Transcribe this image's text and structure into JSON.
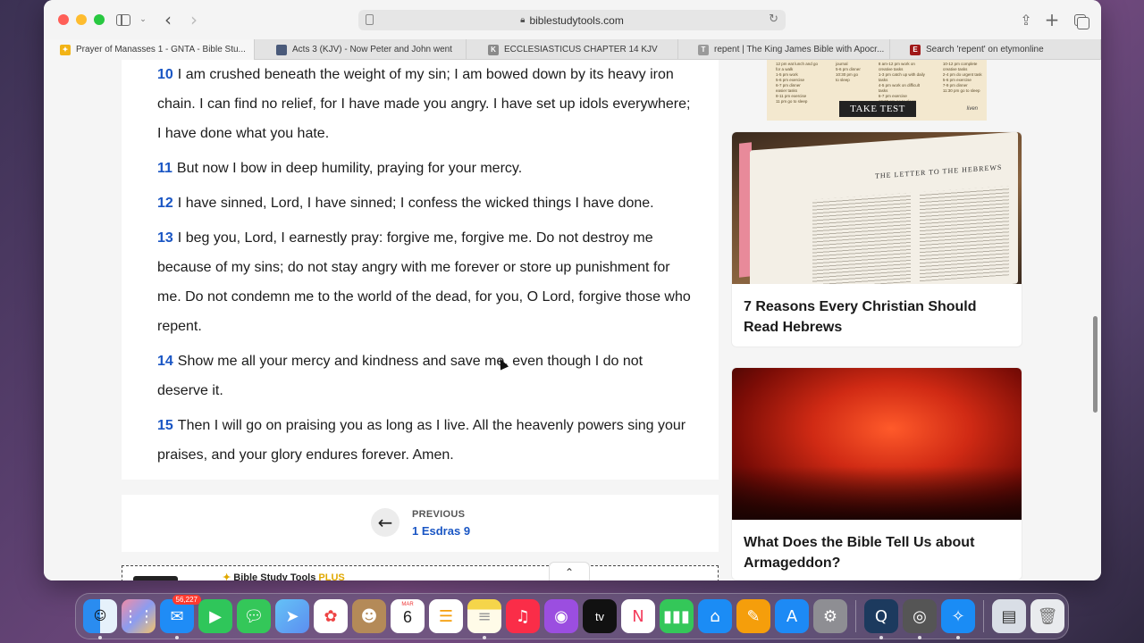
{
  "browser": {
    "url": "biblestudytools.com",
    "tabs": [
      {
        "title": "Prayer of Manasses 1 - GNTA - Bible Stu...",
        "icon": "bible-study-tools-icon",
        "active": true
      },
      {
        "title": "Acts 3 (KJV) - Now Peter and John went",
        "icon": "image-favicon-icon",
        "active": false
      },
      {
        "title": "ECCLESIASTICUS CHAPTER 14 KJV",
        "icon": "k-favicon-icon",
        "active": false
      },
      {
        "title": "repent | The King James Bible with Apocr...",
        "icon": "t-favicon-icon",
        "active": false
      },
      {
        "title": "Search 'repent' on etymonline",
        "icon": "etymonline-icon",
        "active": false
      }
    ]
  },
  "verses": [
    {
      "num": "10",
      "text": "I am crushed beneath the weight of my sin; I am bowed down by its heavy iron chain. I can find no relief, for I have made you angry. I have set up idols everywhere; I have done what you hate."
    },
    {
      "num": "11",
      "text": "But now I bow in deep humility, praying for your mercy."
    },
    {
      "num": "12",
      "text": "I have sinned, Lord, I have sinned; I confess the wicked things I have done."
    },
    {
      "num": "13",
      "text": "I beg you, Lord, I earnestly pray: forgive me, forgive me. Do not destroy me because of my sins; do not stay angry with me forever or store up punishment for me. Do not condemn me to the world of the dead, for you, O Lord, forgive those who repent."
    },
    {
      "num": "14",
      "text": "Show me all your mercy and kindness and save me, even though I do not deserve it."
    },
    {
      "num": "15",
      "text": "Then I will go on praising you as long as I live. All the heavenly powers sing your praises, and your glory endures forever. Amen."
    }
  ],
  "nav": {
    "prev_label": "PREVIOUS",
    "prev_title": "1 Esdras 9"
  },
  "plus_banner": {
    "title": "Bible Study Tools",
    "plus": "PLUS"
  },
  "ad": {
    "button": "TAKE TEST",
    "brand": "liven",
    "col1": [
      "12 pm eat lunch and go",
      "for a walk",
      "1-5 pm work",
      "5-6 pm exercise",
      "6-7 pm dinner",
      "easier tasks",
      "8-11 pm exercise",
      "11 pm go to sleep"
    ],
    "col2": [
      "journal",
      "5-6 pm dinner",
      "10:30 pm go",
      "to sleep"
    ],
    "col3": [
      "8 am-12 pm work on",
      "creative tasks",
      "1-3 pm catch up with daily",
      "tasks",
      "4-5 pm work on difficult",
      "tasks",
      "6-7 pm exercise",
      "10:30 pm go to sleep"
    ],
    "col4": [
      "10-12 pm complete",
      "creative tasks",
      "2-4 pm do urgent task",
      "5-6 pm exercise",
      "7-9 pm dinner",
      "11:30 pm go to sleep"
    ]
  },
  "cards": [
    {
      "title": "7 Reasons Every Christian Should Read Hebrews",
      "image_text": "THE LETTER TO THE HEBREWS"
    },
    {
      "title": "What Does the Bible Tell Us about Armageddon?"
    }
  ],
  "dock": {
    "mail_badge": "56,227",
    "calendar_month": "MAR",
    "calendar_day": "6",
    "tv_label": "tv"
  }
}
